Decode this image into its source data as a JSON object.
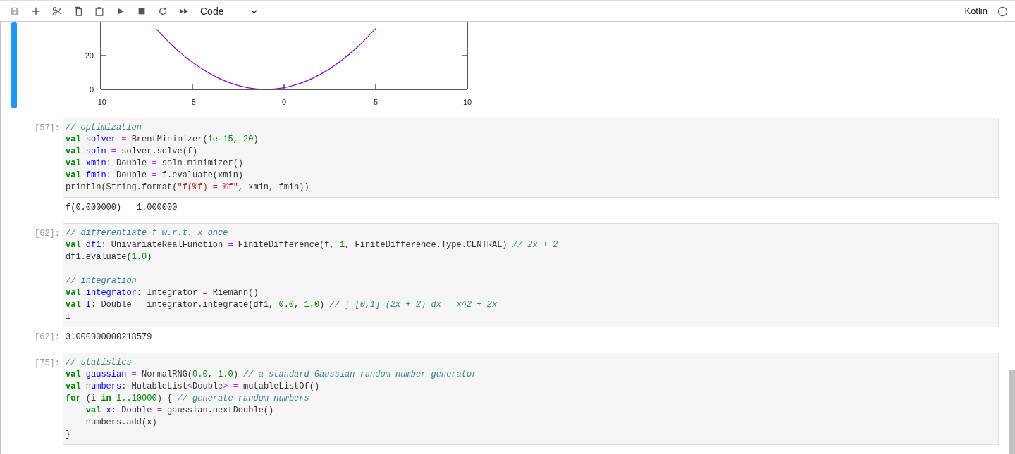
{
  "toolbar": {
    "buttons": [
      {
        "kind": "save",
        "disabled": true
      },
      {
        "kind": "add",
        "disabled": false
      },
      {
        "kind": "cut",
        "disabled": false
      },
      {
        "kind": "copy",
        "disabled": false
      },
      {
        "kind": "paste",
        "disabled": false
      },
      {
        "kind": "run",
        "disabled": false
      },
      {
        "kind": "stop",
        "disabled": false
      },
      {
        "kind": "restart",
        "disabled": false
      },
      {
        "kind": "run-all",
        "disabled": false
      }
    ],
    "cell_type": "Code",
    "kernel": {
      "name": "Kotlin",
      "busy": false
    }
  },
  "cells": [
    {
      "selected": true,
      "chart_data": {
        "type": "line",
        "x": [
          -7,
          -6,
          -5,
          -4,
          -3,
          -2,
          -1,
          0,
          1,
          2,
          3,
          4,
          5
        ],
        "series": [
          {
            "color": "#9400d3",
            "values": [
              36,
              25,
              16,
              9,
              4,
              1,
              0,
              1,
              4,
              9,
              16,
              25,
              36
            ]
          }
        ],
        "xlim": [
          -10,
          10
        ],
        "ylim": [
          0,
          40
        ],
        "xticks": [
          -10,
          -5,
          0,
          5,
          10
        ],
        "yticks": [
          0,
          20
        ]
      }
    },
    {
      "selected": false,
      "prompt": "[57]:",
      "code": [
        [
          {
            "kind": "comment",
            "text": "// optimization"
          }
        ],
        [
          {
            "kind": "keyword",
            "text": "val"
          },
          {
            "kind": "name",
            "text": " solver"
          },
          {
            "kind": "operator",
            "text": " ="
          },
          {
            "kind": "plain",
            "text": " BrentMinimizer("
          },
          {
            "kind": "number",
            "text": "1e-15"
          },
          {
            "kind": "plain",
            "text": ", "
          },
          {
            "kind": "number",
            "text": "20"
          },
          {
            "kind": "plain",
            "text": ")"
          }
        ],
        [
          {
            "kind": "keyword",
            "text": "val"
          },
          {
            "kind": "name",
            "text": " soln"
          },
          {
            "kind": "operator",
            "text": " ="
          },
          {
            "kind": "plain",
            "text": " solver.solve(f)"
          }
        ],
        [
          {
            "kind": "keyword",
            "text": "val"
          },
          {
            "kind": "name",
            "text": " xmin"
          },
          {
            "kind": "plain",
            "text": ": Double "
          },
          {
            "kind": "operator",
            "text": "="
          },
          {
            "kind": "plain",
            "text": " soln.minimizer()"
          }
        ],
        [
          {
            "kind": "keyword",
            "text": "val"
          },
          {
            "kind": "name",
            "text": " fmin"
          },
          {
            "kind": "plain",
            "text": ": Double "
          },
          {
            "kind": "operator",
            "text": "="
          },
          {
            "kind": "plain",
            "text": " f.evaluate(xmin)"
          }
        ],
        [
          {
            "kind": "plain",
            "text": "println(String.format("
          },
          {
            "kind": "string",
            "text": "\"f(%f) = %f\""
          },
          {
            "kind": "plain",
            "text": ", xmin, fmin))"
          }
        ]
      ],
      "outputs": [
        {
          "text": "f(0.000000) = 1.000000"
        }
      ]
    },
    {
      "selected": false,
      "prompt": "[62]:",
      "code": [
        [
          {
            "kind": "comment",
            "text": "// differentiate f w.r.t. x once"
          }
        ],
        [
          {
            "kind": "keyword",
            "text": "val"
          },
          {
            "kind": "name",
            "text": " df1"
          },
          {
            "kind": "plain",
            "text": ": UnivariateRealFunction "
          },
          {
            "kind": "operator",
            "text": "="
          },
          {
            "kind": "plain",
            "text": " FiniteDifference(f, "
          },
          {
            "kind": "number",
            "text": "1"
          },
          {
            "kind": "plain",
            "text": ", FiniteDifference.Type.CENTRAL) "
          },
          {
            "kind": "comment",
            "text": "// 2x + 2"
          }
        ],
        [
          {
            "kind": "plain",
            "text": "df1.evaluate("
          },
          {
            "kind": "number",
            "text": "1.0"
          },
          {
            "kind": "plain",
            "text": ")"
          }
        ],
        {
          "kind": "blank"
        },
        [
          {
            "kind": "comment",
            "text": "// integration"
          }
        ],
        [
          {
            "kind": "keyword",
            "text": "val"
          },
          {
            "kind": "name",
            "text": " integrator"
          },
          {
            "kind": "plain",
            "text": ": Integrator "
          },
          {
            "kind": "operator",
            "text": "="
          },
          {
            "kind": "plain",
            "text": " Riemann()"
          }
        ],
        [
          {
            "kind": "keyword",
            "text": "val"
          },
          {
            "kind": "name",
            "text": " I"
          },
          {
            "kind": "plain",
            "text": ": Double "
          },
          {
            "kind": "operator",
            "text": "="
          },
          {
            "kind": "plain",
            "text": " integrator.integrate(df1, "
          },
          {
            "kind": "number",
            "text": "0.0"
          },
          {
            "kind": "plain",
            "text": ", "
          },
          {
            "kind": "number",
            "text": "1.0"
          },
          {
            "kind": "plain",
            "text": ") "
          },
          {
            "kind": "comment",
            "text": "// ∫_[0,1] (2x + 2) dx = x^2 + 2x"
          }
        ],
        [
          {
            "kind": "plain",
            "text": "I"
          }
        ]
      ],
      "outputs": [
        {
          "prompt": "[62]:",
          "text": "3.000000000218579"
        }
      ]
    },
    {
      "selected": false,
      "prompt": "[75]:",
      "code": [
        [
          {
            "kind": "comment",
            "text": "// statistics"
          }
        ],
        [
          {
            "kind": "keyword",
            "text": "val"
          },
          {
            "kind": "name",
            "text": " gaussian"
          },
          {
            "kind": "operator",
            "text": " ="
          },
          {
            "kind": "plain",
            "text": " NormalRNG("
          },
          {
            "kind": "number",
            "text": "0.0"
          },
          {
            "kind": "plain",
            "text": ", "
          },
          {
            "kind": "number",
            "text": "1.0"
          },
          {
            "kind": "plain",
            "text": ") "
          },
          {
            "kind": "comment",
            "text": "// a standard Gaussian random number generator"
          }
        ],
        [
          {
            "kind": "keyword",
            "text": "val"
          },
          {
            "kind": "name",
            "text": " numbers"
          },
          {
            "kind": "plain",
            "text": ": MutableList"
          },
          {
            "kind": "operator",
            "text": "<"
          },
          {
            "kind": "plain",
            "text": "Double"
          },
          {
            "kind": "operator",
            "text": ">"
          },
          {
            "kind": "operator",
            "text": " ="
          },
          {
            "kind": "plain",
            "text": " mutableListOf()"
          }
        ],
        [
          {
            "kind": "keyword",
            "text": "for"
          },
          {
            "kind": "plain",
            "text": " (i "
          },
          {
            "kind": "keyword",
            "text": "in"
          },
          {
            "kind": "number",
            "text": " 1..10000"
          },
          {
            "kind": "plain",
            "text": ") { "
          },
          {
            "kind": "comment",
            "text": "// generate random numbers"
          }
        ],
        [
          {
            "kind": "keyword",
            "text": "    val"
          },
          {
            "kind": "name",
            "text": " x"
          },
          {
            "kind": "plain",
            "text": ": Double "
          },
          {
            "kind": "operator",
            "text": "="
          },
          {
            "kind": "plain",
            "text": " gaussian.nextDouble()"
          }
        ],
        [
          {
            "kind": "plain",
            "text": "    numbers.add(x)"
          }
        ],
        [
          {
            "kind": "plain",
            "text": "}"
          }
        ]
      ]
    }
  ]
}
